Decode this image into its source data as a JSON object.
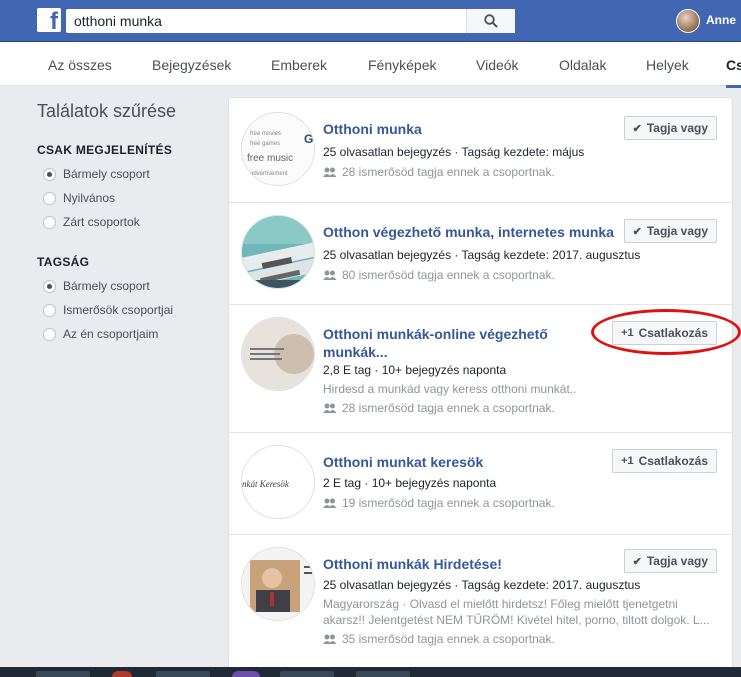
{
  "header": {
    "logo_letter": "f",
    "search_value": "otthoni munka",
    "user_name": "Anne"
  },
  "tabs": [
    {
      "label": "Az összes"
    },
    {
      "label": "Bejegyzések"
    },
    {
      "label": "Emberek"
    },
    {
      "label": "Fényképek"
    },
    {
      "label": "Videók"
    },
    {
      "label": "Oldalak"
    },
    {
      "label": "Helyek"
    },
    {
      "label": "Cs"
    }
  ],
  "filters": {
    "title": "Találatok szűrése",
    "show_only": {
      "heading": "CSAK MEGJELENÍTÉS",
      "options": [
        "Bármely csoport",
        "Nyilvános",
        "Zárt csoportok"
      ]
    },
    "membership": {
      "heading": "TAGSÁG",
      "options": [
        "Bármely csoport",
        "Ismerősök csoportjai",
        "Az én csoportjaim"
      ]
    }
  },
  "results": [
    {
      "title": "Otthoni munka",
      "line1": "25 olvasatlan bejegyzés · Tagság kezdete: május",
      "friends": "28 ismerősöd tagja ennek a csoportnak.",
      "button": "Tagja vagy",
      "thumb_text": [
        "free movies",
        "free games",
        "free music",
        "advertisement"
      ]
    },
    {
      "title": "Otthon végezhető munka, internetes munka",
      "line1": "25 olvasatlan bejegyzés · Tagság kezdete: 2017. augusztus",
      "friends": "80 ismerősöd tagja ennek a csoportnak.",
      "button": "Tagja vagy"
    },
    {
      "title": "Otthoni munkák-online végezhető munkák...",
      "line1": "2,8 E tag · 10+ bejegyzés naponta",
      "desc": "Hirdesd a munkád vagy keress otthoni munkát..",
      "friends": "28 ismerősöd tagja ennek a csoportnak.",
      "button": "Csatlakozás"
    },
    {
      "title": "Otthoni munkat keresök",
      "line1": "2 E tag · 10+ bejegyzés naponta",
      "friends": "19 ismerősöd tagja ennek a csoportnak.",
      "button": "Csatlakozás",
      "thumb_text": [
        "nkát Keresök"
      ]
    },
    {
      "title": "Otthoni munkák Hirdetése!",
      "line1": "25 olvasatlan bejegyzés · Tagság kezdete: 2017. augusztus",
      "desc": "Magyarország · Olvasd el mielőtt hirdetsz! Főleg mielőtt tjenetgetni akarsz!! Jelentgetést NEM TŰRÖM! Kivétel hitel, porno, tiltott dolgok. L...",
      "friends": "35 ismerősöd tagja ennek a csoportnak.",
      "button": "Tagja vagy"
    }
  ],
  "colors": {
    "brand": "#4267b2",
    "link": "#365899",
    "annotation": "#e01010"
  }
}
